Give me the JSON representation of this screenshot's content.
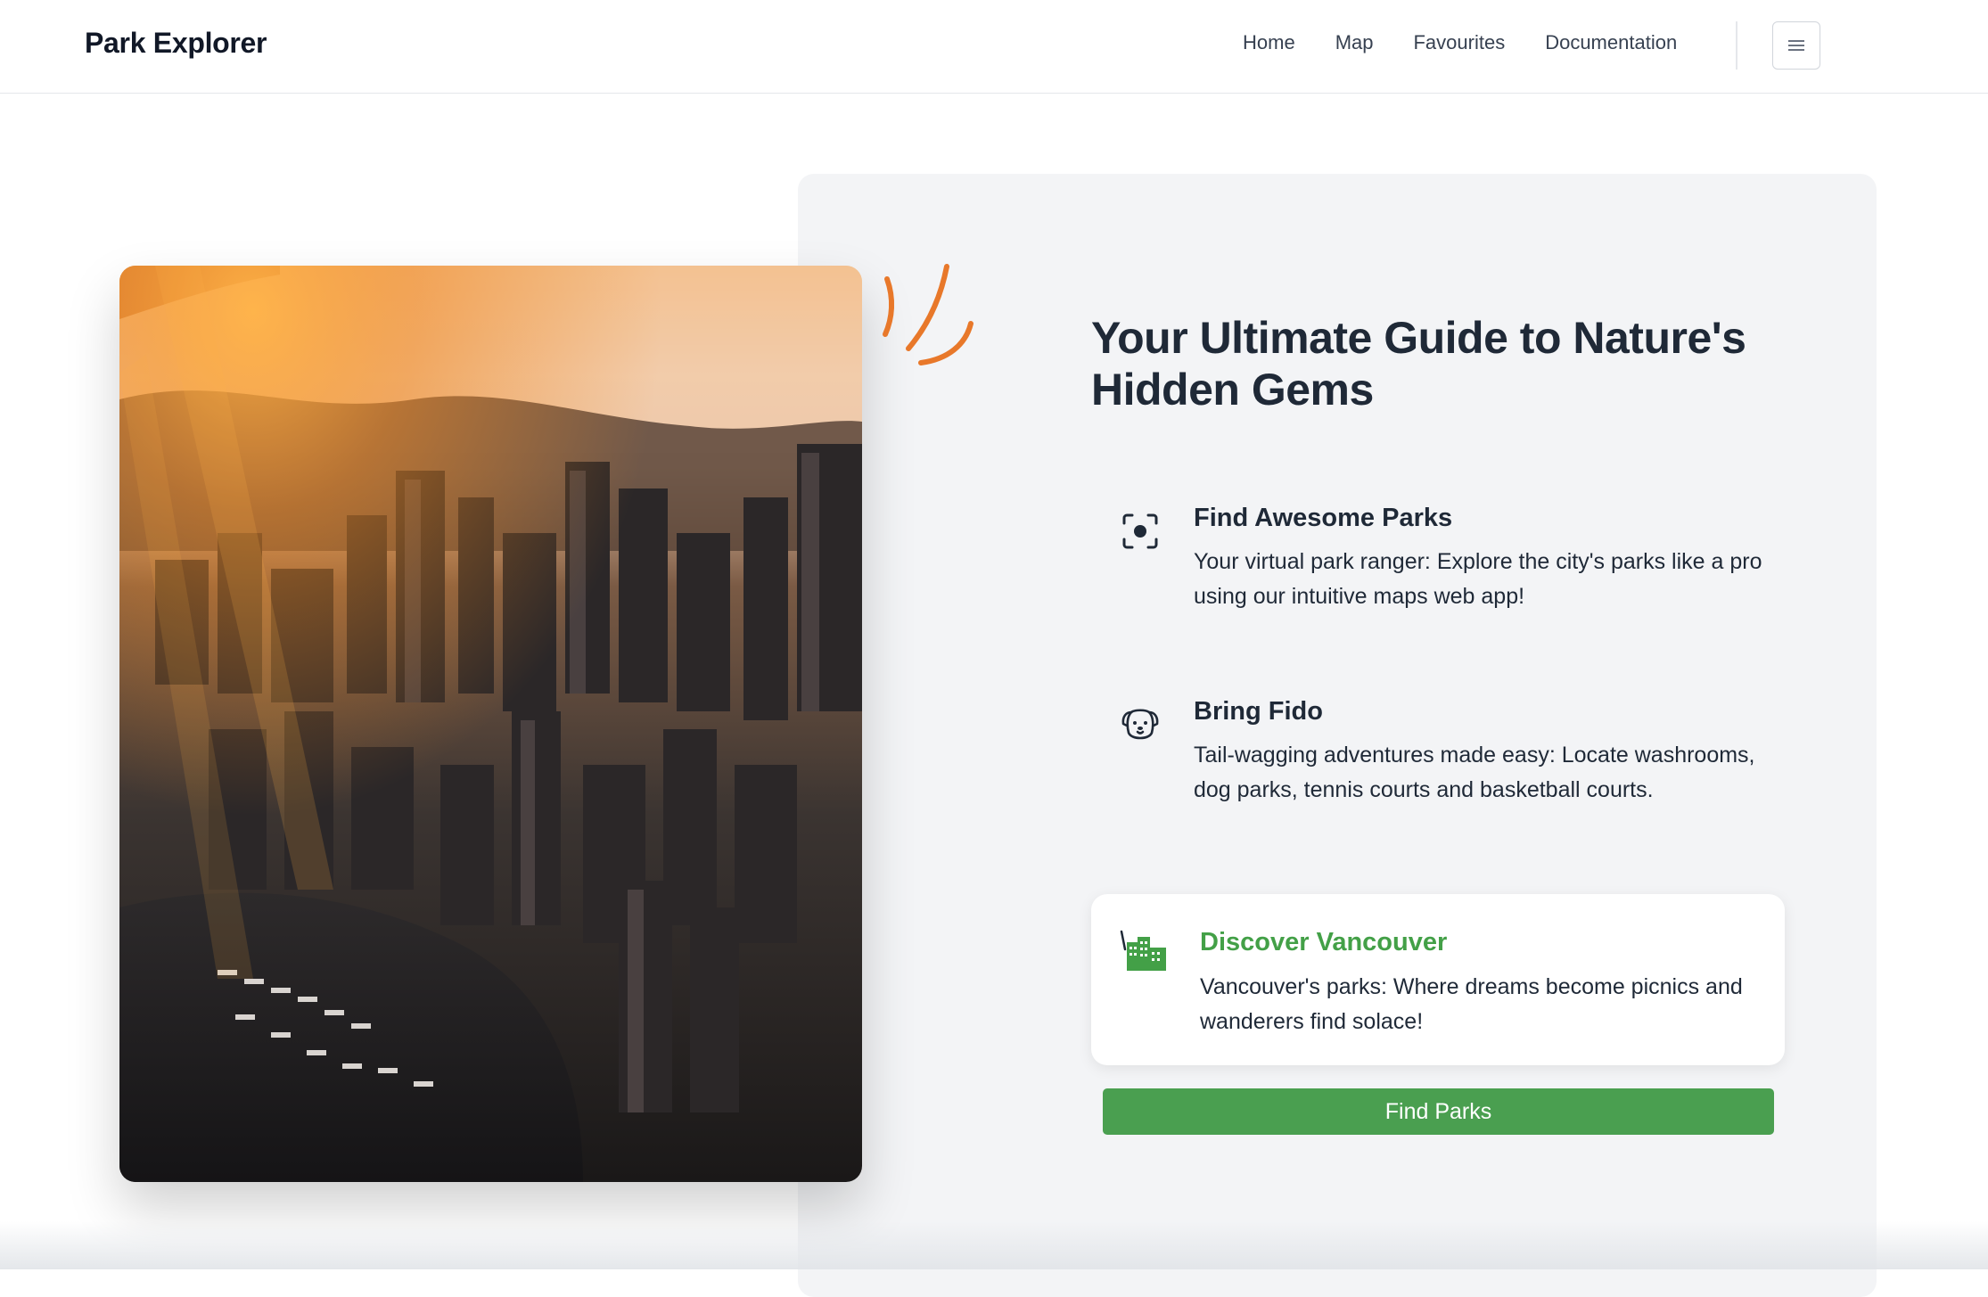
{
  "header": {
    "brand": "Park Explorer",
    "nav": [
      {
        "label": "Home"
      },
      {
        "label": "Map"
      },
      {
        "label": "Favourites"
      },
      {
        "label": "Documentation"
      }
    ],
    "menu_icon": "hamburger-menu-icon"
  },
  "hero": {
    "image_subject": "aerial-city-skyline-at-sunset",
    "headline": "Your Ultimate Guide to Nature's Hidden Gems",
    "features": [
      {
        "icon": "focus-target-icon",
        "title": "Find Awesome Parks",
        "text": "Your virtual park ranger: Explore the city's parks like a pro using our intuitive maps web app!"
      },
      {
        "icon": "dog-icon",
        "title": "Bring Fido",
        "text": "Tail-wagging adventures made easy: Locate washrooms, dog parks, tennis courts and basketball courts."
      },
      {
        "icon": "city-buildings-icon",
        "title": "Discover Vancouver",
        "text": "Vancouver's parks: Where dreams become picnics and wanderers find solace!"
      }
    ],
    "cta_label": "Find Parks"
  },
  "colors": {
    "accent_green": "#4a9f50",
    "accent_orange": "#e8782a",
    "panel_bg": "#f3f4f6"
  }
}
